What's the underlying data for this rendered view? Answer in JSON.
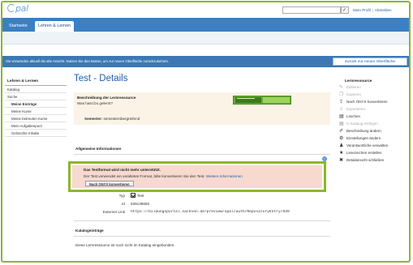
{
  "header": {
    "logo_text": "pal",
    "search_button_glyph": "✓",
    "links": [
      "Mein Profil",
      "Abmelden"
    ]
  },
  "tabs": [
    {
      "label": "Startseite",
      "active": false
    },
    {
      "label": "Lehren & Lernen",
      "active": true
    }
  ],
  "notice": {
    "message": "Sie verwenden aktuell die alte Ansicht. Nutzen Sie den Button, um zur neuen Oberfläche zurückzukehren.",
    "button_label": "Zurück zur neuen Oberfläche"
  },
  "leftnav": {
    "title": "Lehren & Lernen",
    "items": [
      {
        "label": "Katalog",
        "sub": false,
        "bold": false
      },
      {
        "label": "Suche",
        "sub": false,
        "bold": false
      },
      {
        "label": "Meine Einträge",
        "sub": true,
        "bold": true
      },
      {
        "label": "Meine Kurse",
        "sub": true,
        "bold": false
      },
      {
        "label": "Meine betreuten Kurse",
        "sub": true,
        "bold": false
      },
      {
        "label": "Mein Aufgabenpool",
        "sub": true,
        "bold": false
      },
      {
        "label": "Gelöschte Inhalte",
        "sub": true,
        "bold": false
      }
    ]
  },
  "main": {
    "title": "Test - Details",
    "description": {
      "heading": "Beschreibung der Lernressource",
      "text": "Was hast Du gelernt?",
      "semester_label": "Semester:",
      "semester_value": "semesterübergreifend"
    },
    "general_info_title": "Allgemeine Informationen",
    "warning": {
      "title": "Das Testformat wird nicht mehr unterstützt.",
      "text": "Der Test verwendet ein veraltetes Format, bitte konvertieren Sie den Test.",
      "link": "Weitere Informationen",
      "button": "Nach ONYX konvertieren"
    },
    "fields": {
      "typ_label": "Typ",
      "typ_value": "Test",
      "id_label": "Id",
      "id_value": "639139655",
      "link_label": "Externer Link",
      "link_value": "https://bildungsportal.sachsen.de/preview/opal/auth/RepositoryEntry/639"
    },
    "catalog_title": "Katalogeinträge",
    "catalog_text": "Diese Lernressource ist noch nicht im Katalog eingebunden."
  },
  "rightbar": {
    "title": "Lernressource",
    "items": [
      {
        "label": "Editieren",
        "icon": "edit-icon",
        "glyph": "✎",
        "disabled": true
      },
      {
        "label": "Kopieren",
        "icon": "copy-icon",
        "glyph": "❐",
        "disabled": true
      },
      {
        "label": "Nach ONYX konvertieren",
        "icon": "convert-icon",
        "glyph": "⇪",
        "disabled": false
      },
      {
        "label": "Exportieren",
        "icon": "export-icon",
        "glyph": "⇩",
        "disabled": true
      },
      {
        "label": "Löschen",
        "icon": "delete-icon",
        "glyph": "▤",
        "disabled": false
      },
      {
        "label": "In Katalog einfügen",
        "icon": "catalog-icon",
        "glyph": "▦",
        "disabled": true
      },
      {
        "label": "Beschreibung ändern",
        "icon": "pencil-icon",
        "glyph": "✐",
        "disabled": false
      },
      {
        "label": "Einstellungen ändern",
        "icon": "gear-icon",
        "glyph": "⚙",
        "disabled": false
      },
      {
        "label": "Verantwortliche verwalten",
        "icon": "user-icon",
        "glyph": "♟",
        "disabled": false
      },
      {
        "label": "Lesezeichen erstellen",
        "icon": "bookmark-icon",
        "glyph": "★",
        "disabled": false
      },
      {
        "label": "Detailansicht schließen",
        "icon": "close-icon",
        "glyph": "✖",
        "disabled": false
      }
    ]
  },
  "colors": {
    "accent_green": "#8db52c",
    "bar_blue": "#3b7fc4",
    "link_blue": "#2262a8",
    "warning_bg": "#f7d9cf",
    "description_bg": "#fbf3e6"
  }
}
